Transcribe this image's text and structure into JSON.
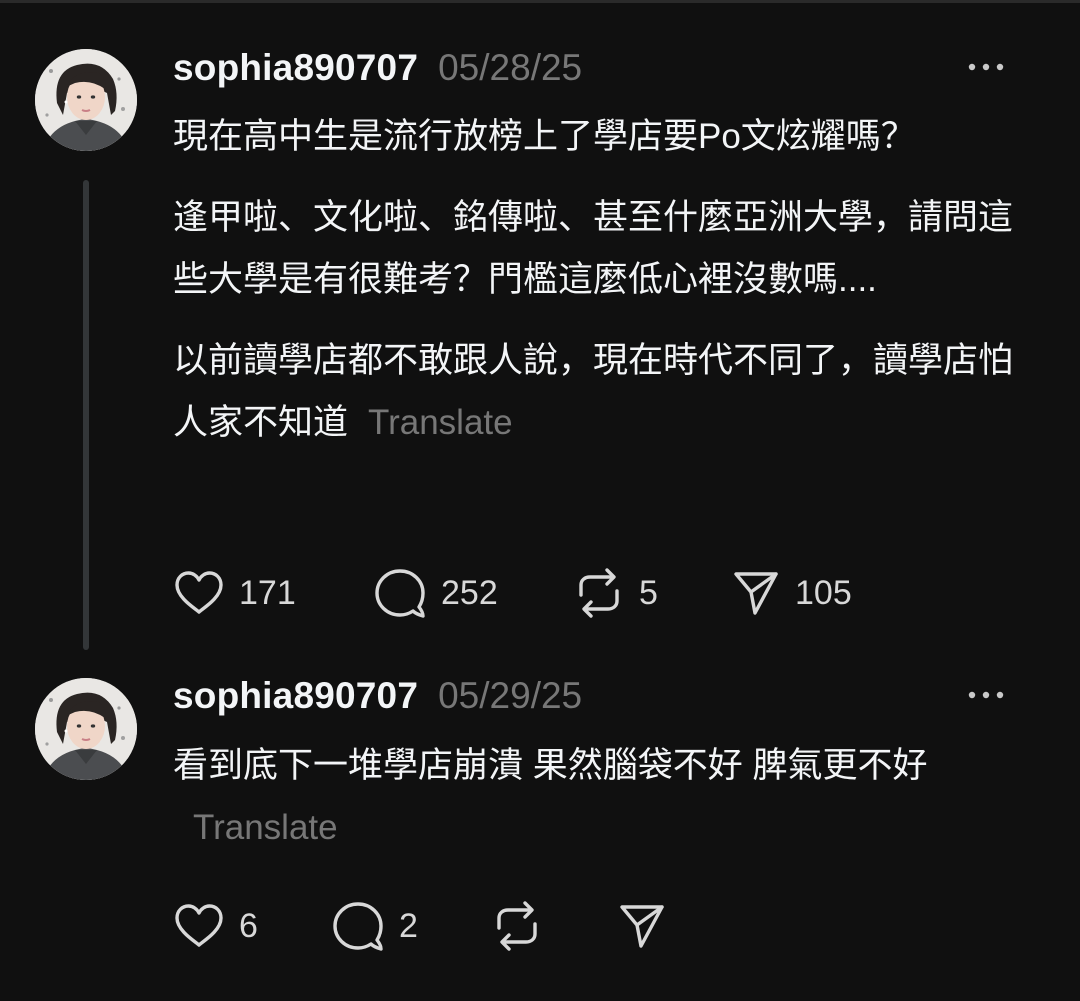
{
  "posts": [
    {
      "username": "sophia890707",
      "timestamp": "05/28/25",
      "paragraphs": [
        "現在高中生是流行放榜上了學店要Po文炫耀嗎？",
        "逢甲啦、文化啦、銘傳啦、甚至什麼亞洲大學，請問這些大學是有很難考？門檻這麼低心裡沒數嗎....",
        "以前讀學店都不敢跟人說，現在時代不同了，讀學店怕人家不知道"
      ],
      "translate_label": "Translate",
      "likes": "171",
      "replies": "252",
      "reposts": "5",
      "shares": "105"
    },
    {
      "username": "sophia890707",
      "timestamp": "05/29/25",
      "paragraphs": [
        "看到底下一堆學店崩潰 果然腦袋不好 脾氣更不好"
      ],
      "translate_label": "Translate",
      "likes": "6",
      "replies": "2",
      "reposts": "",
      "shares": ""
    }
  ],
  "icons": {
    "like": "heart-icon",
    "reply": "speech-bubble-icon",
    "repost": "repost-arrows-icon",
    "share": "paper-plane-icon",
    "more": "more-dots-icon"
  },
  "colors": {
    "background": "#101010",
    "text": "#f3f5f7",
    "muted": "#777777",
    "thread_line": "#333638"
  }
}
